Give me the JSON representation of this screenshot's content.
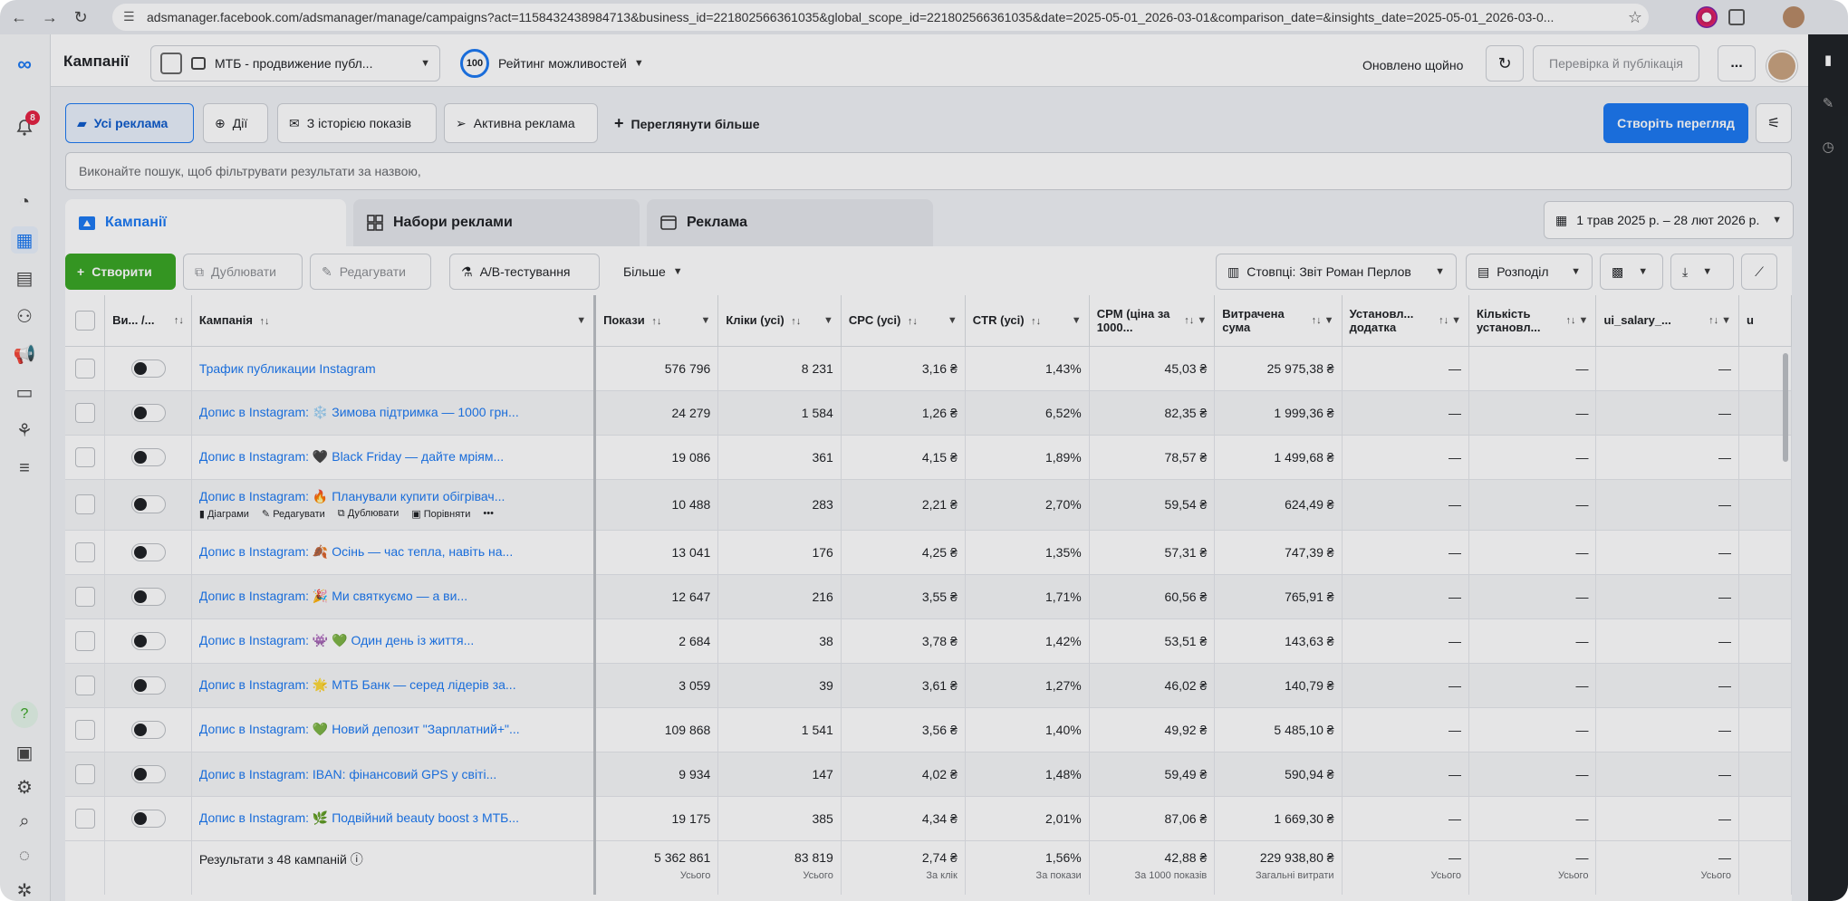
{
  "browser": {
    "url": "adsmanager.facebook.com/adsmanager/manage/campaigns?act=1158432438984713&business_id=221802566361035&global_scope_id=221802566361035&date=2025-05-01_2026-03-01&comparison_date=&insights_date=2025-05-01_2026-03-0..."
  },
  "rail": {
    "notification_count": "8"
  },
  "header": {
    "title": "Кампанії",
    "account": "МТБ - продвижение публ...",
    "opportunity_score": "100",
    "opportunity_label": "Рейтинг можливостей",
    "updated_text": "Оновлено щойно",
    "review_label": "Перевірка й публікація",
    "more_label": "..."
  },
  "chips": {
    "all_ads": "Усі реклама",
    "actions": "Дії",
    "with_history": "З історією показів",
    "active_ads": "Активна реклама",
    "see_more": "Переглянути більше",
    "create_view": "Створіть перегляд"
  },
  "search": {
    "placeholder": "Виконайте пошук, щоб фільтрувати результати за назвою,"
  },
  "tabs": {
    "campaigns": "Кампанії",
    "ad_sets": "Набори реклами",
    "ads": "Реклама",
    "date_range": "1 трав 2025 р. – 28 лют 2026 р."
  },
  "toolbar": {
    "create": "Створити",
    "duplicate": "Дублювати",
    "edit": "Редагувати",
    "ab_test": "A/B-тестування",
    "more": "Більше",
    "columns": "Стовпці: Звіт Роман Перлов",
    "breakdown": "Розподіл"
  },
  "table": {
    "headers": {
      "delivery": "Ви... /...",
      "campaign": "Кампанія",
      "impressions": "Покази",
      "clicks": "Кліки (усі)",
      "cpc": "CPC (усі)",
      "ctr": "CTR (усі)",
      "cpm": "CPM (ціна за 1000...",
      "spend": "Витрачена сума",
      "installs_app": "Установл... додатка",
      "installs_count": "Кількість установл...",
      "ui_salary": "ui_salary_...",
      "extra": "u"
    },
    "row_actions": {
      "charts": "Діаграми",
      "edit": "Редагувати",
      "duplicate": "Дублювати",
      "compare": "Порівняти",
      "more": "•••"
    },
    "rows": [
      {
        "name": "Трафик публикации Instagram",
        "impressions": "576 796",
        "clicks": "8 231",
        "cpc": "3,16 ₴",
        "ctr": "1,43%",
        "cpm": "45,03 ₴",
        "spend": "25 975,38 ₴",
        "c1": "—",
        "c2": "—",
        "c3": "—"
      },
      {
        "name": "Допис в Instagram: ❄️ Зимова підтримка — 1000 грн...",
        "impressions": "24 279",
        "clicks": "1 584",
        "cpc": "1,26 ₴",
        "ctr": "6,52%",
        "cpm": "82,35 ₴",
        "spend": "1 999,36 ₴",
        "c1": "—",
        "c2": "—",
        "c3": "—"
      },
      {
        "name": "Допис в Instagram: 🖤 Black Friday — дайте мріям...",
        "impressions": "19 086",
        "clicks": "361",
        "cpc": "4,15 ₴",
        "ctr": "1,89%",
        "cpm": "78,57 ₴",
        "spend": "1 499,68 ₴",
        "c1": "—",
        "c2": "—",
        "c3": "—"
      },
      {
        "name": "Допис в Instagram: 🔥 Планували купити обігрівач...",
        "impressions": "10 488",
        "clicks": "283",
        "cpc": "2,21 ₴",
        "ctr": "2,70%",
        "cpm": "59,54 ₴",
        "spend": "624,49 ₴",
        "c1": "—",
        "c2": "—",
        "c3": "—",
        "hover": true
      },
      {
        "name": "Допис в Instagram: 🍂 Осінь — час тепла, навіть на...",
        "impressions": "13 041",
        "clicks": "176",
        "cpc": "4,25 ₴",
        "ctr": "1,35%",
        "cpm": "57,31 ₴",
        "spend": "747,39 ₴",
        "c1": "—",
        "c2": "—",
        "c3": "—"
      },
      {
        "name": "Допис в Instagram: 🎉 Ми святкуємо — а ви...",
        "impressions": "12 647",
        "clicks": "216",
        "cpc": "3,55 ₴",
        "ctr": "1,71%",
        "cpm": "60,56 ₴",
        "spend": "765,91 ₴",
        "c1": "—",
        "c2": "—",
        "c3": "—"
      },
      {
        "name": "Допис в Instagram: 👾 💚 Один день із життя...",
        "impressions": "2 684",
        "clicks": "38",
        "cpc": "3,78 ₴",
        "ctr": "1,42%",
        "cpm": "53,51 ₴",
        "spend": "143,63 ₴",
        "c1": "—",
        "c2": "—",
        "c3": "—"
      },
      {
        "name": "Допис в Instagram: 🌟 МТБ Банк — серед лідерів за...",
        "impressions": "3 059",
        "clicks": "39",
        "cpc": "3,61 ₴",
        "ctr": "1,27%",
        "cpm": "46,02 ₴",
        "spend": "140,79 ₴",
        "c1": "—",
        "c2": "—",
        "c3": "—"
      },
      {
        "name": "Допис в Instagram: 💚 Новий депозит \"Зарплатний+\"...",
        "impressions": "109 868",
        "clicks": "1 541",
        "cpc": "3,56 ₴",
        "ctr": "1,40%",
        "cpm": "49,92 ₴",
        "spend": "5 485,10 ₴",
        "c1": "—",
        "c2": "—",
        "c3": "—"
      },
      {
        "name": "Допис в Instagram: IBAN: фінансовий GPS у світі...",
        "impressions": "9 934",
        "clicks": "147",
        "cpc": "4,02 ₴",
        "ctr": "1,48%",
        "cpm": "59,49 ₴",
        "spend": "590,94 ₴",
        "c1": "—",
        "c2": "—",
        "c3": "—"
      },
      {
        "name": "Допис в Instagram: 🌿 Подвійний beauty boost з МТБ...",
        "impressions": "19 175",
        "clicks": "385",
        "cpc": "4,34 ₴",
        "ctr": "2,01%",
        "cpm": "87,06 ₴",
        "spend": "1 669,30 ₴",
        "c1": "—",
        "c2": "—",
        "c3": "—"
      }
    ],
    "totals": {
      "label": "Результати з 48 кампаній",
      "impressions": "5 362 861",
      "impressions_sub": "Усього",
      "clicks": "83 819",
      "clicks_sub": "Усього",
      "cpc": "2,74 ₴",
      "cpc_sub": "За клік",
      "ctr": "1,56%",
      "ctr_sub": "За покази",
      "cpm": "42,88 ₴",
      "cpm_sub": "За 1000 показів",
      "spend": "229 938,80 ₴",
      "spend_sub": "Загальні витрати",
      "c1": "—",
      "c1_sub": "Усього",
      "c2": "—",
      "c2_sub": "Усього",
      "c3": "—",
      "c3_sub": "Усього"
    }
  },
  "colors": {
    "accent": "#1877f2",
    "create_green": "#36a420",
    "rail_dark": "#1c1f23"
  }
}
